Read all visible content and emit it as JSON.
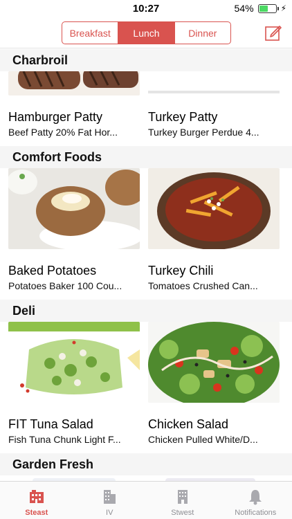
{
  "status": {
    "time": "10:27",
    "battery": "54%",
    "battery_level": 0.54
  },
  "header": {
    "meals": [
      {
        "label": "Breakfast",
        "active": false
      },
      {
        "label": "Lunch",
        "active": true
      },
      {
        "label": "Dinner",
        "active": false
      }
    ],
    "compose_icon": "compose-icon"
  },
  "sections": [
    {
      "title": "Charbroil",
      "items": [
        {
          "name": "Hamburger Patty",
          "desc": "Beef Patty 20% Fat Hor...",
          "image": "hamburger-patty-photo"
        },
        {
          "name": "Turkey Patty",
          "desc": "Turkey Burger Perdue 4...",
          "image": "turkey-patty-photo"
        }
      ]
    },
    {
      "title": "Comfort Foods",
      "items": [
        {
          "name": "Baked Potatoes",
          "desc": "Potatoes Baker 100 Cou...",
          "image": "baked-potato-photo"
        },
        {
          "name": "Turkey Chili",
          "desc": "Tomatoes Crushed Can...",
          "image": "turkey-chili-photo"
        }
      ]
    },
    {
      "title": "Deli",
      "items": [
        {
          "name": "FIT Tuna Salad",
          "desc": "Fish Tuna Chunk Light F...",
          "image": "tuna-salad-photo"
        },
        {
          "name": "Chicken Salad",
          "desc": "Chicken Pulled White/D...",
          "image": "chicken-salad-photo"
        }
      ]
    },
    {
      "title": "Garden Fresh",
      "items": []
    }
  ],
  "tabs": [
    {
      "label": "Steast",
      "icon": "building-icon",
      "active": true
    },
    {
      "label": "IV",
      "icon": "building-icon",
      "active": false
    },
    {
      "label": "Stwest",
      "icon": "building-icon",
      "active": false
    },
    {
      "label": "Notifications",
      "icon": "bell-icon",
      "active": false
    }
  ],
  "colors": {
    "accent": "#d9534f",
    "inactive": "#8e8e93",
    "battery": "#4cd964"
  }
}
